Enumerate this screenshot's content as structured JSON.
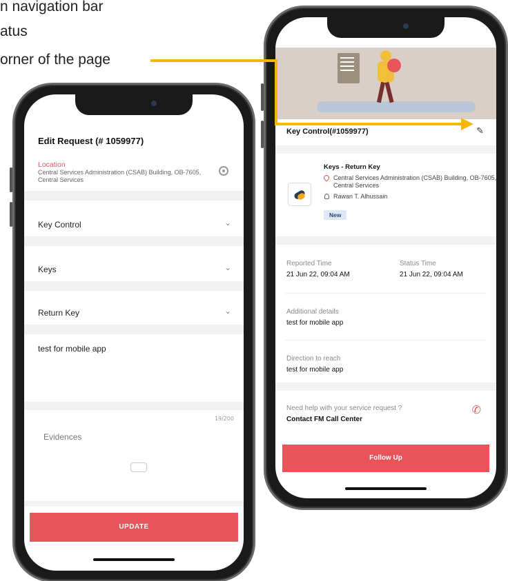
{
  "captions": [
    "n navigation bar",
    "atus",
    "orner of the page"
  ],
  "annotation": {
    "arrow_color": "#f5b800"
  },
  "edit_screen": {
    "title": "Edit Request (# 1059977)",
    "location_label": "Location",
    "location_text": "Central Services Administration (CSAB) Building, OB-7605, Central Services",
    "category": "Key Control",
    "subcategory": "Keys",
    "issue": "Return Key",
    "description": "test for mobile app",
    "char_counter": "19/200",
    "evidences_label": "Evidences",
    "update_button": "UPDATE"
  },
  "detail_screen": {
    "title": "Key Control(#1059977)",
    "request_title": "Keys - Return Key",
    "request_location": "Central Services Administration (CSAB) Building, OB-7605, Central Services",
    "requester": "Rawan T. Alhussain",
    "status_badge": "New",
    "reported_time_label": "Reported Time",
    "reported_time": "21 Jun 22, 09:04 AM",
    "status_time_label": "Status Time",
    "status_time": "21 Jun 22, 09:04 AM",
    "additional_label": "Additional details",
    "additional_value": "test for mobile app",
    "direction_label": "Direction to reach",
    "direction_value": "test for mobile app",
    "help_text": "Need help with your service request ?",
    "help_link": "Contact FM Call Center",
    "follow_button": "Follow Up"
  },
  "colors": {
    "accent": "#e7555a",
    "badge_bg": "#dde9f7",
    "badge_text": "#27466e"
  }
}
